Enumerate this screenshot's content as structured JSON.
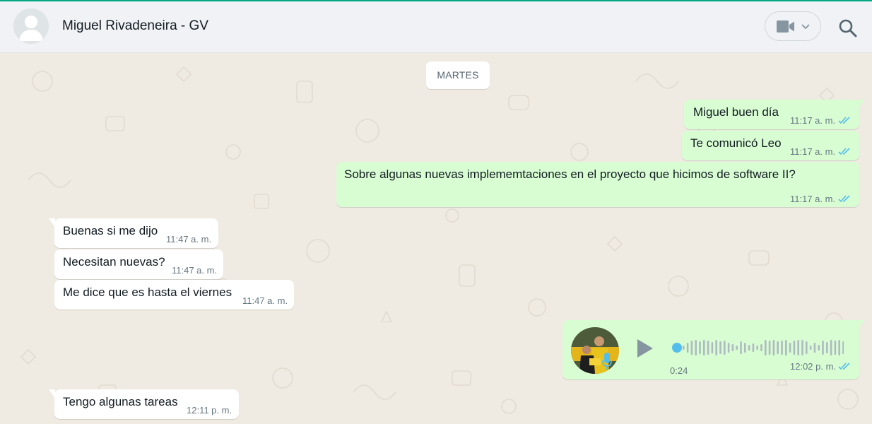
{
  "header": {
    "contact_name": "Miguel Rivadeneira - GV",
    "avatar_icon": "default-avatar-icon",
    "video_icon": "video-camera-icon",
    "dropdown_icon": "chevron-down-icon",
    "search_icon": "search-icon"
  },
  "chat": {
    "date_label": "MARTES",
    "messages": [
      {
        "direction": "outgoing",
        "text": "Miguel buen día",
        "time": "11:17 a. m.",
        "status": "read"
      },
      {
        "direction": "outgoing",
        "text": "Te comunicó Leo",
        "time": "11:17 a. m.",
        "status": "read"
      },
      {
        "direction": "outgoing",
        "text": "Sobre algunas nuevas implememtaciones en el proyecto que hicimos de software II?",
        "time": "11:17 a. m.",
        "status": "read"
      },
      {
        "direction": "incoming",
        "text": "Buenas si me dijo",
        "time": "11:47 a. m."
      },
      {
        "direction": "incoming",
        "text": "Necesitan nuevas?",
        "time": "11:47 a. m."
      },
      {
        "direction": "incoming",
        "text": "Me dice que es hasta el viernes",
        "time": "11:47 a. m."
      },
      {
        "direction": "outgoing",
        "type": "voice",
        "duration": "0:24",
        "time": "12:02 p. m.",
        "status": "read",
        "progress": 0
      },
      {
        "direction": "incoming",
        "text": "Tengo algunas tareas",
        "time": "12:11 p. m."
      }
    ]
  },
  "colors": {
    "accent": "#00a884",
    "outgoing_bubble": "#d9fdd3",
    "incoming_bubble": "#ffffff",
    "read_tick": "#53bdeb",
    "chat_background": "#efeae2"
  }
}
